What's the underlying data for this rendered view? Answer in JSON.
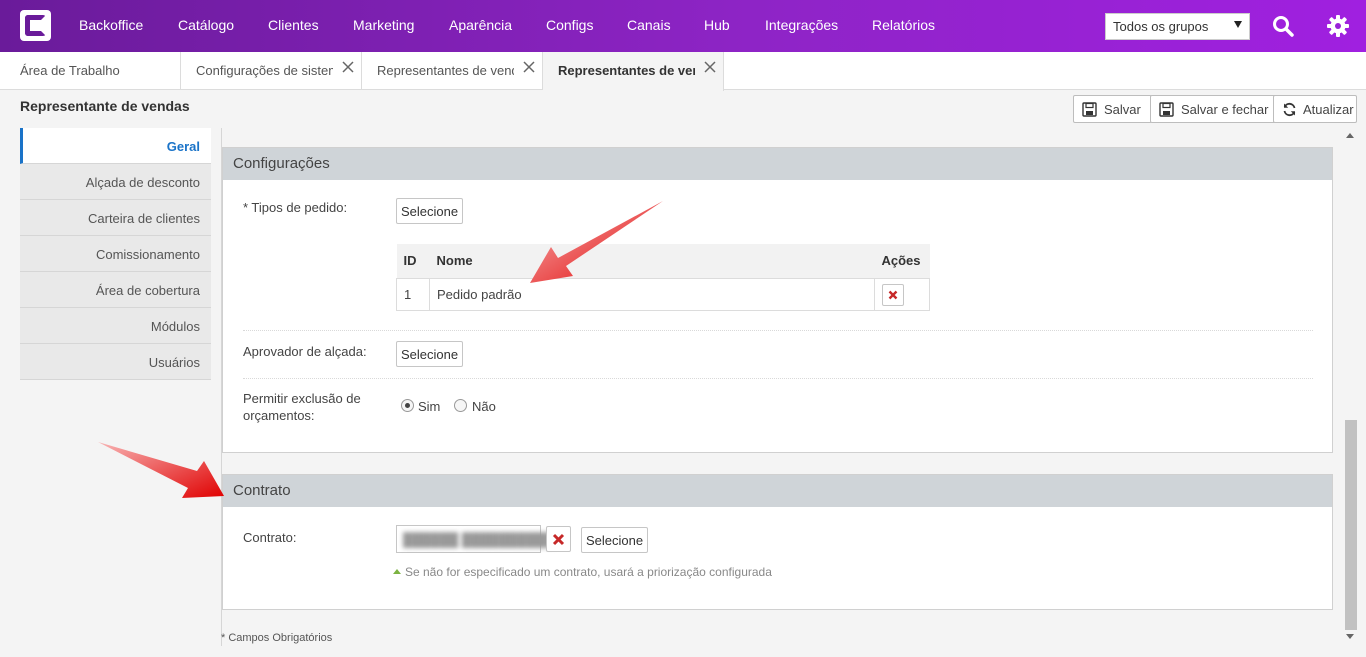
{
  "nav": {
    "items": [
      {
        "label": "Backoffice"
      },
      {
        "label": "Catálogo"
      },
      {
        "label": "Clientes"
      },
      {
        "label": "Marketing"
      },
      {
        "label": "Aparência"
      },
      {
        "label": "Configs"
      },
      {
        "label": "Canais"
      },
      {
        "label": "Hub"
      },
      {
        "label": "Integrações"
      },
      {
        "label": "Relatórios"
      }
    ],
    "group_select": "Todos os grupos",
    "icons": [
      "logo-icon",
      "search-icon",
      "gear-icon"
    ]
  },
  "tabs": [
    {
      "label": "Área de Trabalho"
    },
    {
      "label": "Configurações de sistema"
    },
    {
      "label": "Representantes de vendas"
    },
    {
      "label": "Representantes de vendas"
    }
  ],
  "header": {
    "title": "Representante de vendas",
    "save_label": "Salvar",
    "save_close_label": "Salvar e fechar",
    "refresh_label": "Atualizar"
  },
  "sidebar": {
    "items": [
      {
        "label": "Geral"
      },
      {
        "label": "Alçada de desconto"
      },
      {
        "label": "Carteira de clientes"
      },
      {
        "label": "Comissionamento"
      },
      {
        "label": "Área de cobertura"
      },
      {
        "label": "Módulos"
      },
      {
        "label": "Usuários"
      }
    ]
  },
  "config_panel": {
    "title": "Configurações",
    "order_types_label": "* Tipos de pedido:",
    "select_label": "Selecione",
    "table": {
      "headers": [
        "ID",
        "Nome",
        "Ações"
      ],
      "rows": [
        {
          "id": "1",
          "name": "Pedido padrão"
        }
      ]
    },
    "approver_label": "Aprovador de alçada:",
    "allow_delete_label_1": "Permitir exclusão de",
    "allow_delete_label_2": "orçamentos:",
    "yes_label": "Sim",
    "no_label": "Não"
  },
  "contract_panel": {
    "title": "Contrato",
    "contract_label": "Contrato:",
    "select_label": "Selecione",
    "hint": "Se não for especificado um contrato, usará a priorização configurada"
  },
  "footer": {
    "required_note": "* Campos Obrigatórios"
  },
  "colors": {
    "nav_start": "#6a1b9a",
    "nav_end": "#a020e0",
    "accent": "#1a73c8",
    "delete": "#c62828",
    "arrow": "#e53935"
  }
}
